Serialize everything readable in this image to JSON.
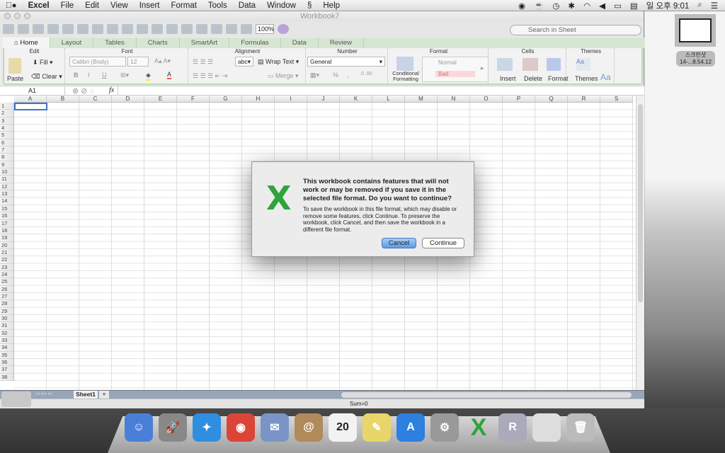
{
  "menubar": {
    "apple": "",
    "app": "Excel",
    "items": [
      "File",
      "Edit",
      "View",
      "Insert",
      "Format",
      "Tools",
      "Data",
      "Window",
      "Script",
      "Help"
    ],
    "clock": "일 오후 9:01",
    "script_glyph": "§"
  },
  "window": {
    "title": "Workbook7",
    "zoom": "100%",
    "search_placeholder": "Search in Sheet"
  },
  "tabs": [
    "Home",
    "Layout",
    "Tables",
    "Charts",
    "SmartArt",
    "Formulas",
    "Data",
    "Review"
  ],
  "ribbon": {
    "groups": {
      "edit": "Edit",
      "font": "Font",
      "alignment": "Alignment",
      "number": "Number",
      "format": "Format",
      "cells": "Cells",
      "themes": "Themes"
    },
    "paste": "Paste",
    "fill": "Fill",
    "clear": "Clear",
    "font_name": "Calibri (Body)",
    "font_size": "12",
    "bold": "B",
    "italic": "I",
    "underline": "U",
    "wrap": "abc",
    "wrap_text": "Wrap Text",
    "merge": "Merge",
    "number_format": "General",
    "percent": "%",
    "comma": ",",
    "conditional": "Conditional Formatting",
    "style_normal": "Normal",
    "style_bad": "Bad",
    "insert": "Insert",
    "delete": "Delete",
    "format": "Format",
    "themes": "Themes",
    "aa": "Aa"
  },
  "formula_bar": {
    "cell": "A1",
    "fx": "fx",
    "value": ""
  },
  "columns": [
    "A",
    "B",
    "C",
    "D",
    "E",
    "F",
    "G",
    "H",
    "I",
    "J",
    "K",
    "L",
    "M",
    "N",
    "O",
    "P",
    "Q",
    "R",
    "S"
  ],
  "rows": [
    1,
    2,
    3,
    4,
    5,
    6,
    7,
    8,
    9,
    10,
    11,
    12,
    13,
    14,
    15,
    16,
    17,
    18,
    19,
    20,
    21,
    22,
    23,
    24,
    25,
    26,
    27,
    28,
    29,
    30,
    31,
    32,
    33,
    34,
    35,
    36,
    37,
    38
  ],
  "sheets": [
    "Sheet1"
  ],
  "add_sheet": "+",
  "status": {
    "sum": "Sum=0"
  },
  "dialog": {
    "heading": "This workbook contains features that will not work or may be removed if you save it in the selected file format. Do you want to continue?",
    "body": "To save the workbook in this file format, which may disable or remove some features, click Continue. To preserve the workbook, click Cancel, and then save the workbook in a different file format.",
    "cancel": "Cancel",
    "continue": "Continue"
  },
  "desktop": {
    "file_label_1": "스크린샷",
    "file_label_2": "14-...8.54.12"
  },
  "dock": [
    {
      "name": "finder",
      "color": "#4a7fd8",
      "g": "☺"
    },
    {
      "name": "launchpad",
      "color": "#888",
      "g": "🚀"
    },
    {
      "name": "safari",
      "color": "#2f8ee0",
      "g": "✦"
    },
    {
      "name": "chrome",
      "color": "#db4437",
      "g": "◉"
    },
    {
      "name": "mail",
      "color": "#7a94c8",
      "g": "✉"
    },
    {
      "name": "contacts",
      "color": "#b08a5a",
      "g": "@"
    },
    {
      "name": "calendar",
      "color": "#f2f2f2",
      "g": "20"
    },
    {
      "name": "stickies",
      "color": "#e8d66a",
      "g": "✎"
    },
    {
      "name": "app-store",
      "color": "#2d7fe0",
      "g": "A"
    },
    {
      "name": "system-preferences",
      "color": "#999",
      "g": "⚙"
    },
    {
      "name": "excel",
      "color": "transparent",
      "g": "X"
    },
    {
      "name": "r",
      "color": "#aab",
      "g": "R"
    },
    {
      "name": "drive",
      "color": "#ddd",
      "g": ""
    },
    {
      "name": "trash",
      "color": "#bbb",
      "g": "🗑"
    }
  ]
}
